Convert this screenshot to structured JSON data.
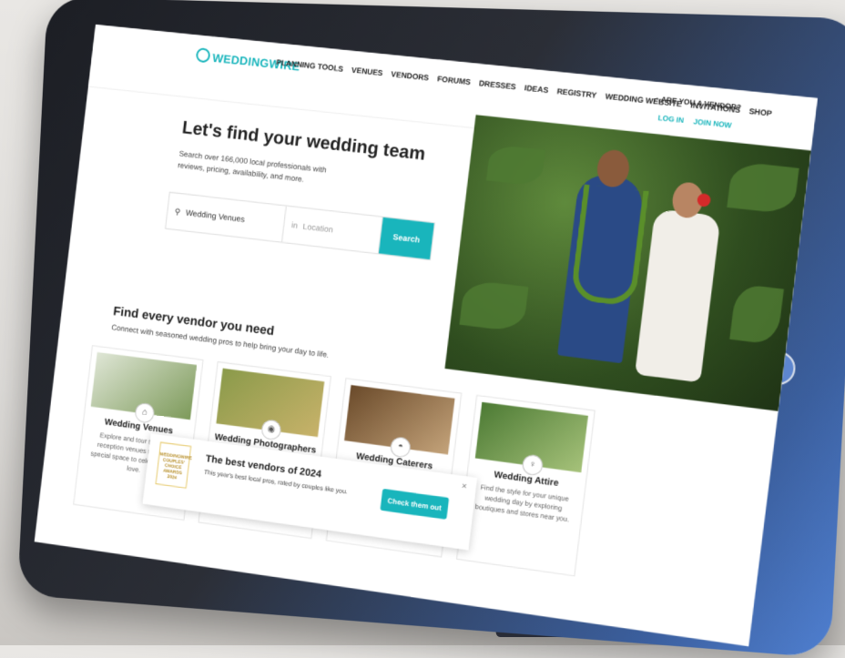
{
  "nav": {
    "logo": "WEDDINGWIRE",
    "links": [
      "PLANNING TOOLS",
      "VENUES",
      "VENDORS",
      "FORUMS",
      "DRESSES",
      "IDEAS",
      "REGISTRY",
      "WEDDING WEBSITE",
      "INVITATIONS",
      "SHOP"
    ],
    "vendor_prompt": "ARE YOU A VENDOR?",
    "login": "LOG IN",
    "join": "JOIN NOW"
  },
  "hero": {
    "title": "Let's find your wedding team",
    "subtitle": "Search over 166,000 local professionals with reviews, pricing, availability, and more.",
    "search_value": "Wedding Venues",
    "location_prefix": "in",
    "location_placeholder": "Location",
    "search_button": "Search"
  },
  "vendors": {
    "title": "Find every vendor you need",
    "subtitle": "Connect with seasoned wedding pros to help bring your day to life.",
    "cards": [
      {
        "title": "Wedding Venues",
        "desc": "Explore and tour top-rated reception venues to book a special space to celebrate your love."
      },
      {
        "title": "Wedding Photographers",
        "desc": ""
      },
      {
        "title": "Wedding Caterers",
        "desc": ""
      },
      {
        "title": "Wedding Attire",
        "desc": "Find the style for your unique wedding day by exploring boutiques and stores near you."
      }
    ]
  },
  "popup": {
    "badge": "WEDDINGWIRE COUPLES' CHOICE AWARDS 2024",
    "title": "The best vendors of 2024",
    "subtitle": "This year's best local pros, rated by couples like you.",
    "button": "Check them out",
    "close": "×"
  },
  "colors": {
    "accent": "#19b5bc"
  }
}
